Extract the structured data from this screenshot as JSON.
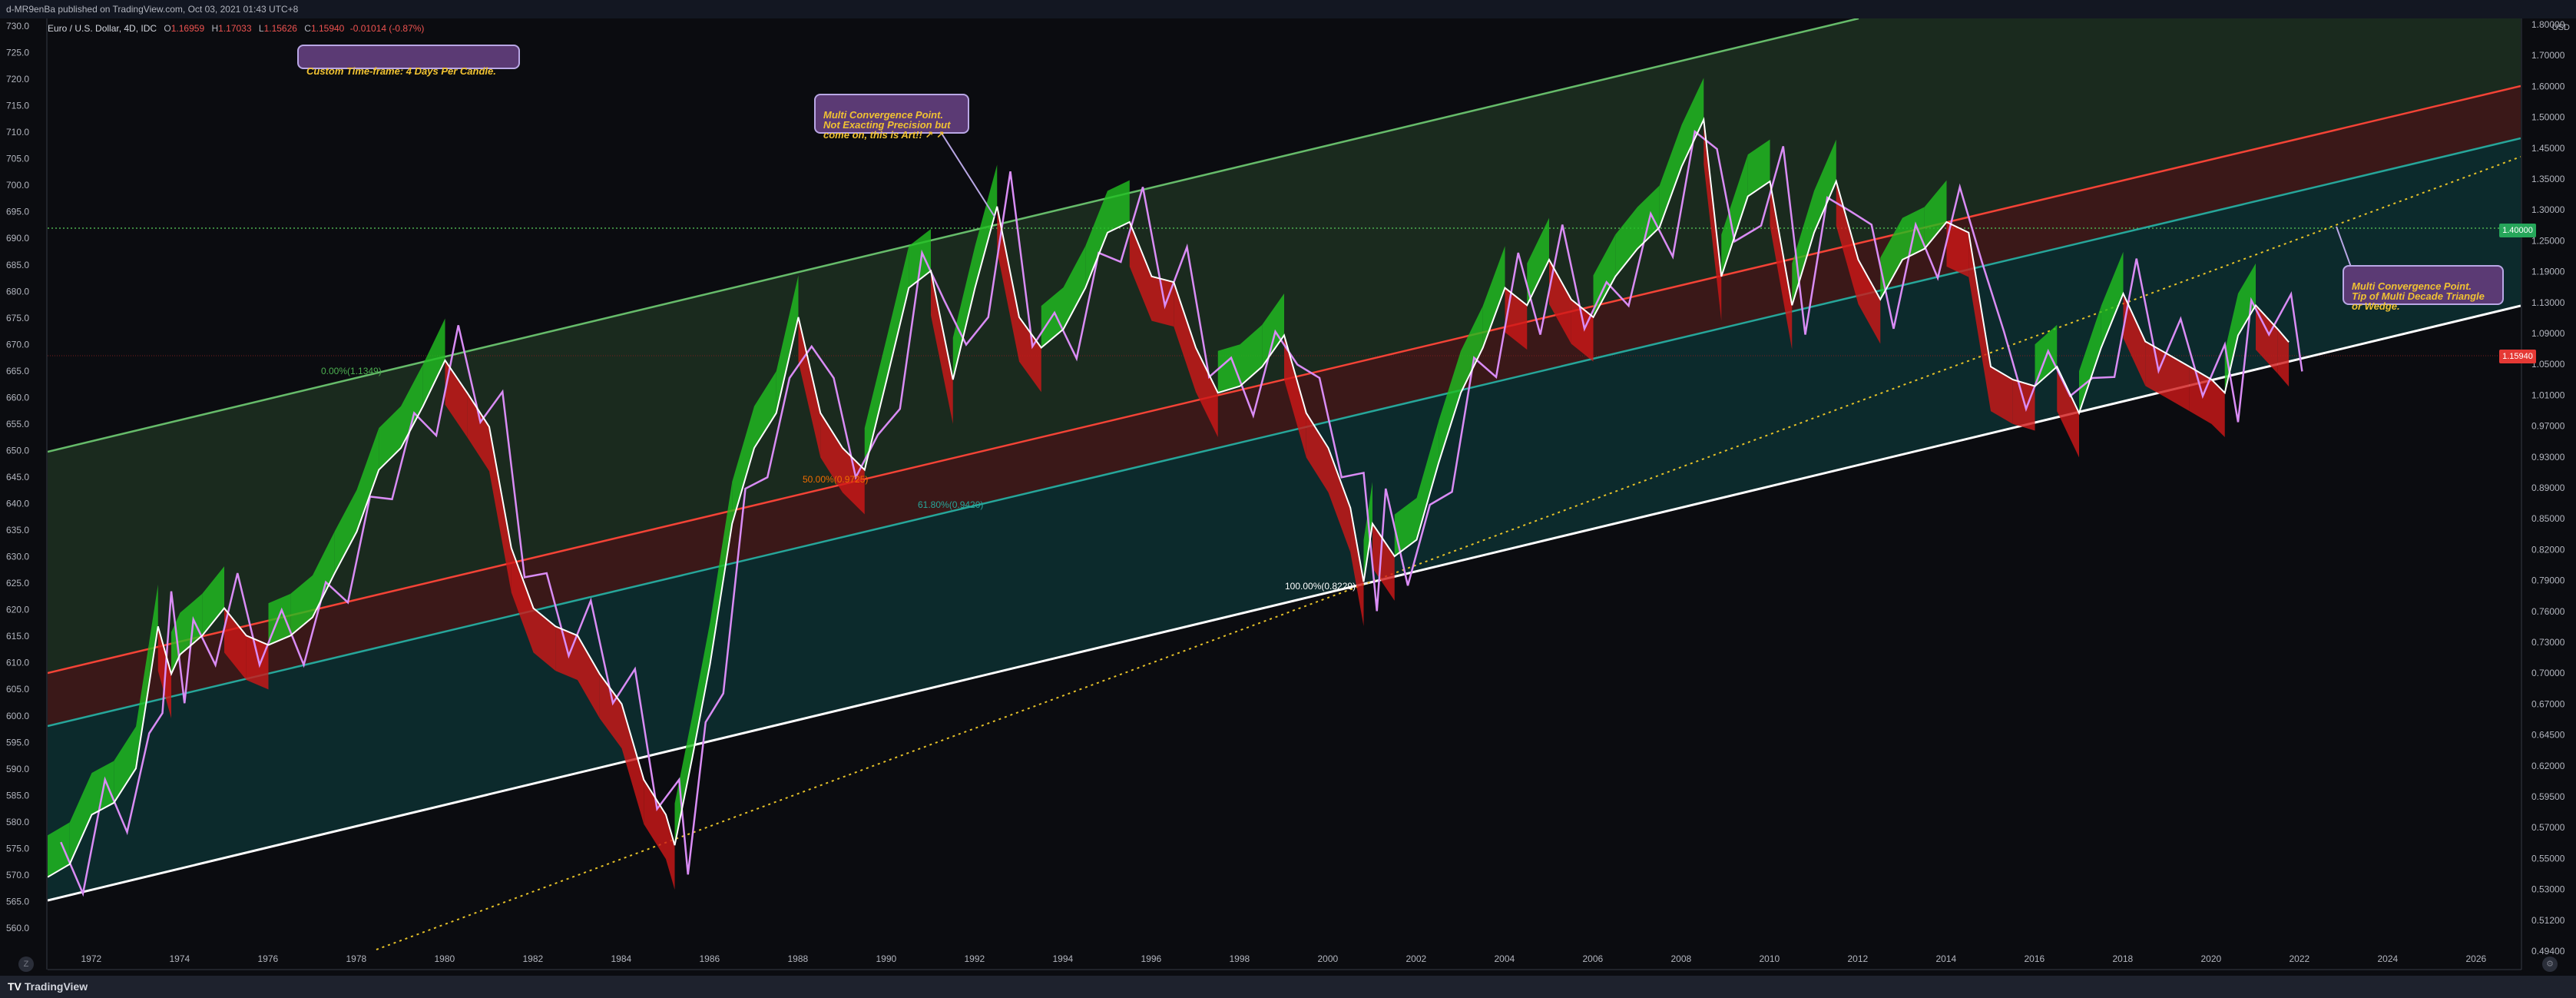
{
  "header": {
    "publisher": "d-MR9enBa published on TradingView.com, Oct 03, 2021 01:43 UTC+8"
  },
  "legend": {
    "symbol": "Euro / U.S. Dollar, 4D, IDC",
    "open_label": "O",
    "open": "1.16959",
    "high_label": "H",
    "high": "1.17033",
    "low_label": "L",
    "low": "1.15626",
    "close_label": "C",
    "close": "1.15940",
    "change": "-0.01014 (-0.87%)"
  },
  "annotations": {
    "timeframe": "Custom Time-frame: 4 Days Per Candle.",
    "convergence_1": "Multi Convergence Point.\nNot Exacting Precision but\ncome on, this is Art!! ↗ ↗",
    "convergence_2": "Multi Convergence Point.\nTip of Multi Decade Triangle\nor Wedge."
  },
  "fib_labels": {
    "f0": "0.00%(1.1349)",
    "f50": "50.00%(0.9725)",
    "f618": "61.80%(0.9420)",
    "f100": "100.00%(0.8229)"
  },
  "price_tags": {
    "level": "1.40000",
    "last": "1.15940",
    "currency": "USD"
  },
  "left_axis": [
    "730.0",
    "725.0",
    "720.0",
    "715.0",
    "710.0",
    "705.0",
    "700.0",
    "695.0",
    "690.0",
    "685.0",
    "680.0",
    "675.0",
    "670.0",
    "665.0",
    "660.0",
    "655.0",
    "650.0",
    "645.0",
    "640.0",
    "635.0",
    "630.0",
    "625.0",
    "620.0",
    "615.0",
    "610.0",
    "605.0",
    "600.0",
    "595.0",
    "590.0",
    "585.0",
    "580.0",
    "575.0",
    "570.0",
    "565.0",
    "560.0"
  ],
  "right_axis": [
    "1.80000",
    "1.70000",
    "1.60000",
    "1.50000",
    "1.45000",
    "1.35000",
    "1.30000",
    "1.25000",
    "1.19000",
    "1.13000",
    "1.09000",
    "1.05000",
    "1.01000",
    "0.97000",
    "0.93000",
    "0.89000",
    "0.85000",
    "0.82000",
    "0.79000",
    "0.76000",
    "0.73000",
    "0.70000",
    "0.67000",
    "0.64500",
    "0.62000",
    "0.59500",
    "0.57000",
    "0.55000",
    "0.53000",
    "0.51200",
    "0.49400"
  ],
  "time_axis": [
    "1972",
    "1974",
    "1976",
    "1978",
    "1980",
    "1982",
    "1984",
    "1986",
    "1988",
    "1990",
    "1992",
    "1994",
    "1996",
    "1998",
    "2000",
    "2002",
    "2004",
    "2006",
    "2008",
    "2010",
    "2012",
    "2014",
    "2016",
    "2018",
    "2020",
    "2022",
    "2024",
    "2026"
  ],
  "footer": {
    "brand": "TradingView",
    "brand_icon": "TV"
  },
  "colors": {
    "green_line": "#66bb6a",
    "red_line": "#f44336",
    "teal_line": "#26a69a",
    "white_line": "#ffffff",
    "yellow_dotted": "#e6c229",
    "green_dotted": "#4caf50",
    "envelope": "#d98cf5",
    "bull": "#20c020",
    "bear": "#d01818"
  },
  "chart_data": {
    "type": "line",
    "title": "Euro / U.S. Dollar, 4D, IDC",
    "xlabel": "",
    "ylabel": "",
    "y_scale": "log",
    "xlim": [
      1971,
      2027
    ],
    "ylim": [
      0.494,
      1.8
    ],
    "series": [
      {
        "values": [
          [
            1971.0,
            0.55
          ],
          [
            1971.5,
            0.56
          ],
          [
            1972.0,
            0.6
          ],
          [
            1972.5,
            0.61
          ],
          [
            1973.0,
            0.64
          ],
          [
            1973.3,
            0.72
          ],
          [
            1973.5,
            0.78
          ],
          [
            1973.8,
            0.73
          ],
          [
            1974.0,
            0.75
          ],
          [
            1974.5,
            0.77
          ],
          [
            1975.0,
            0.8
          ],
          [
            1975.5,
            0.77
          ],
          [
            1976.0,
            0.76
          ],
          [
            1976.5,
            0.77
          ],
          [
            1977.0,
            0.79
          ],
          [
            1977.5,
            0.84
          ],
          [
            1978.0,
            0.89
          ],
          [
            1978.5,
            0.97
          ],
          [
            1979.0,
            1.0
          ],
          [
            1979.5,
            1.06
          ],
          [
            1980.0,
            1.13
          ],
          [
            1980.5,
            1.08
          ],
          [
            1981.0,
            1.03
          ],
          [
            1981.5,
            0.87
          ],
          [
            1982.0,
            0.8
          ],
          [
            1982.5,
            0.78
          ],
          [
            1983.0,
            0.77
          ],
          [
            1983.5,
            0.73
          ],
          [
            1984.0,
            0.7
          ],
          [
            1984.5,
            0.63
          ],
          [
            1985.0,
            0.6
          ],
          [
            1985.2,
            0.575
          ],
          [
            1985.6,
            0.65
          ],
          [
            1986.0,
            0.74
          ],
          [
            1986.5,
            0.9
          ],
          [
            1987.0,
            1.0
          ],
          [
            1987.5,
            1.05
          ],
          [
            1988.0,
            1.2
          ],
          [
            1988.5,
            1.05
          ],
          [
            1989.0,
            1.0
          ],
          [
            1989.5,
            0.97
          ],
          [
            1990.0,
            1.1
          ],
          [
            1990.5,
            1.25
          ],
          [
            1991.0,
            1.28
          ],
          [
            1991.5,
            1.1
          ],
          [
            1992.0,
            1.25
          ],
          [
            1992.5,
            1.4
          ],
          [
            1993.0,
            1.2
          ],
          [
            1993.5,
            1.15
          ],
          [
            1994.0,
            1.18
          ],
          [
            1994.5,
            1.25
          ],
          [
            1995.0,
            1.35
          ],
          [
            1995.5,
            1.37
          ],
          [
            1996.0,
            1.27
          ],
          [
            1996.5,
            1.26
          ],
          [
            1997.0,
            1.15
          ],
          [
            1997.5,
            1.08
          ],
          [
            1998.0,
            1.09
          ],
          [
            1998.5,
            1.12
          ],
          [
            1999.0,
            1.17
          ],
          [
            1999.5,
            1.05
          ],
          [
            2000.0,
            1.0
          ],
          [
            2000.5,
            0.92
          ],
          [
            2000.8,
            0.83
          ],
          [
            2001.0,
            0.9
          ],
          [
            2001.5,
            0.86
          ],
          [
            2002.0,
            0.88
          ],
          [
            2002.5,
            0.98
          ],
          [
            2003.0,
            1.08
          ],
          [
            2003.5,
            1.15
          ],
          [
            2004.0,
            1.25
          ],
          [
            2004.5,
            1.22
          ],
          [
            2005.0,
            1.3
          ],
          [
            2005.5,
            1.23
          ],
          [
            2006.0,
            1.2
          ],
          [
            2006.5,
            1.27
          ],
          [
            2007.0,
            1.32
          ],
          [
            2007.5,
            1.36
          ],
          [
            2008.0,
            1.48
          ],
          [
            2008.5,
            1.58
          ],
          [
            2008.9,
            1.27
          ],
          [
            2009.5,
            1.42
          ],
          [
            2010.0,
            1.45
          ],
          [
            2010.5,
            1.22
          ],
          [
            2011.0,
            1.35
          ],
          [
            2011.5,
            1.45
          ],
          [
            2012.0,
            1.3
          ],
          [
            2012.5,
            1.23
          ],
          [
            2013.0,
            1.3
          ],
          [
            2013.5,
            1.32
          ],
          [
            2014.0,
            1.37
          ],
          [
            2014.5,
            1.35
          ],
          [
            2015.0,
            1.12
          ],
          [
            2015.5,
            1.1
          ],
          [
            2016.0,
            1.09
          ],
          [
            2016.5,
            1.12
          ],
          [
            2017.0,
            1.05
          ],
          [
            2017.5,
            1.15
          ],
          [
            2018.0,
            1.24
          ],
          [
            2018.5,
            1.16
          ],
          [
            2019.0,
            1.14
          ],
          [
            2019.5,
            1.12
          ],
          [
            2020.0,
            1.1
          ],
          [
            2020.3,
            1.08
          ],
          [
            2020.6,
            1.17
          ],
          [
            2021.0,
            1.22
          ],
          [
            2021.5,
            1.18
          ],
          [
            2021.75,
            1.159
          ]
        ]
      }
    ],
    "legend": "none",
    "grid": false
  }
}
